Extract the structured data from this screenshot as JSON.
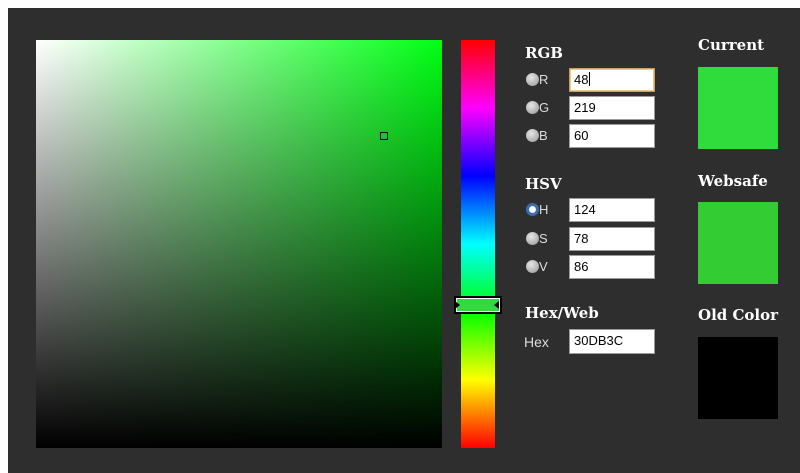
{
  "rgb": {
    "title": "RGB",
    "rows": [
      {
        "label": "R",
        "value": "48",
        "checked": false
      },
      {
        "label": "G",
        "value": "219",
        "checked": false
      },
      {
        "label": "B",
        "value": "60",
        "checked": false
      }
    ]
  },
  "hsv": {
    "title": "HSV",
    "rows": [
      {
        "label": "H",
        "value": "124",
        "checked": true
      },
      {
        "label": "S",
        "value": "78",
        "checked": false
      },
      {
        "label": "V",
        "value": "86",
        "checked": false
      }
    ]
  },
  "hexweb": {
    "title": "Hex/Web",
    "label": "Hex",
    "value": "30DB3C"
  },
  "swatches": {
    "current": {
      "title": "Current",
      "color": "#30db3c"
    },
    "websafe": {
      "title": "Websafe",
      "color": "#33cc33"
    },
    "old": {
      "title": "Old Color",
      "color": "#000000"
    }
  },
  "colors": {
    "panel": "#2e2e2e",
    "hue_base": "#00ff14",
    "radio_accent": "#3c6da8"
  }
}
